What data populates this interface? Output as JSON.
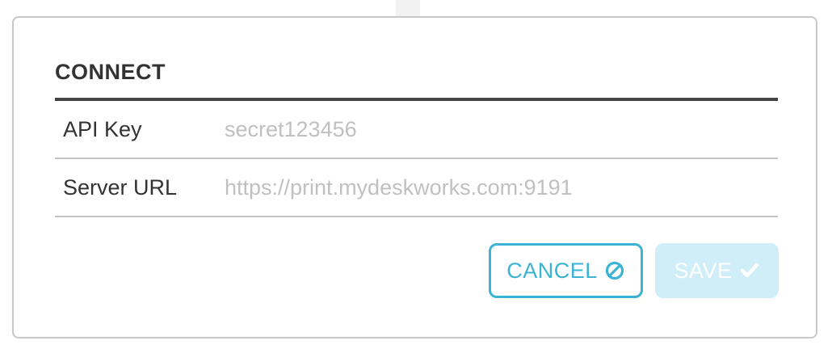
{
  "dialog": {
    "title": "CONNECT",
    "fields": [
      {
        "label": "API Key",
        "placeholder": "secret123456"
      },
      {
        "label": "Server URL",
        "placeholder": "https://print.mydeskworks.com:9191"
      }
    ],
    "buttons": {
      "cancel_label": "CANCEL",
      "save_label": "SAVE"
    }
  },
  "colors": {
    "accent": "#3ab3d6",
    "save_disabled_bg": "#cfeef8",
    "title_text": "#333333",
    "placeholder_text": "#c0c0c0"
  },
  "icons": {
    "cancel": "cancel-circle-slash-icon",
    "save": "checkmark-icon"
  }
}
